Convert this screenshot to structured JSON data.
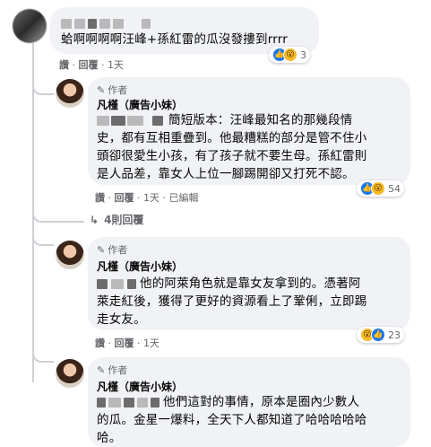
{
  "top_comment": {
    "text": "蛤啊啊啊啊汪峰+孫紅雷的瓜沒發摟到rrrr",
    "actions": [
      "讚",
      "回覆",
      "1天"
    ],
    "reaction_count": "3"
  },
  "replies": [
    {
      "author_badge": "作者",
      "author_name": "凡槿（廣告小妹）",
      "text_line1": "簡短版本：汪峰最知名的那幾段情",
      "text_lines": [
        "史，都有互相重疊到。他最糟糕的部分是管不住小",
        "頭卻很愛生小孩，有了孩子就不要生母。孫紅雷則",
        "是人品差，靠女人上位一腳踢開卻又打死不認。"
      ],
      "actions": [
        "讚",
        "回覆",
        "1天",
        "已編輯"
      ],
      "reaction_count": "54"
    },
    {
      "author_badge": "作者",
      "author_name": "凡槿（廣告小妹）",
      "text_line1": "他的阿萊角色就是靠女友拿到的。憑著阿",
      "text_lines": [
        "萊走紅後，獲得了更好的資源看上了鞏俐，立即踢",
        "走女友。"
      ],
      "actions": [
        "讚",
        "回覆",
        "1天"
      ],
      "reaction_count": "23"
    },
    {
      "author_badge": "作者",
      "author_name": "凡槿（廣告小妹）",
      "text_line1": "他們這對的事情，原本是圈內少數人",
      "text_lines": [
        "的瓜。金星一爆料，全天下人都知道了哈哈哈哈哈",
        "哈。"
      ]
    }
  ],
  "more_replies": "4則回覆",
  "icons": {
    "like": "like-icon",
    "wow": "wow-icon",
    "author": "pen-icon",
    "reply_arrow": "reply-arrow-icon"
  },
  "colors": {
    "bubble": "#f0f2f5",
    "meta": "#65676b",
    "like_blue": "#1877f2"
  }
}
